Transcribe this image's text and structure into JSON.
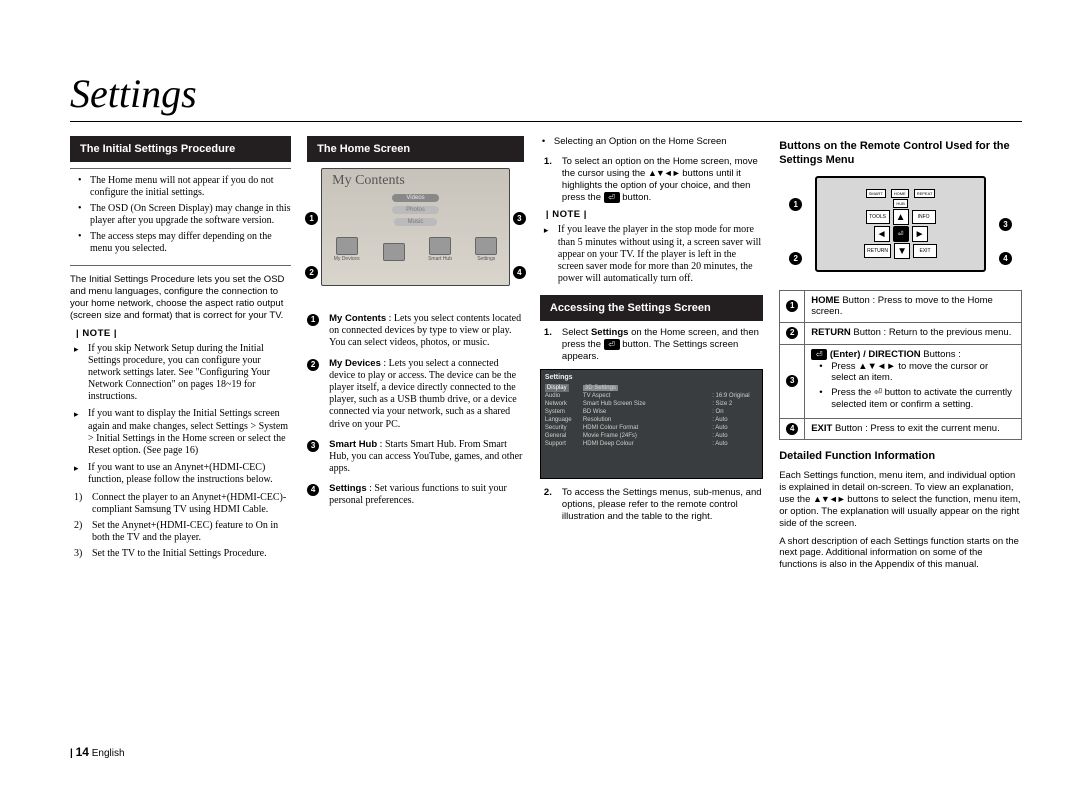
{
  "page_title": "Settings",
  "footer": {
    "page_number": "14",
    "lang": "English"
  },
  "col1": {
    "heading": "The Initial Settings Procedure",
    "top_box": [
      "The Home menu will not appear if you do not configure the initial settings.",
      "The OSD (On Screen Display) may change in this player after you upgrade the software version.",
      "The access steps may differ depending on the menu you selected."
    ],
    "intro": "The Initial Settings Procedure lets you set the OSD and menu languages, configure the connection to your home network, choose the aspect ratio output (screen size and format) that is correct for your TV.",
    "note_label": "NOTE",
    "notes": [
      "If you skip Network Setup during the Initial Settings procedure, you can configure your network settings later. See \"Configuring Your Network Connection\" on pages 18~19 for instructions.",
      "If you want to display the Initial Settings screen again and make changes, select Settings > System > Initial Settings in the Home screen or select the Reset option. (See page 16)",
      "If you want to use an Anynet+(HDMI-CEC) function, please follow the instructions below."
    ],
    "steps": [
      "Connect the player to an Anynet+(HDMI-CEC)-compliant Samsung TV using HDMI Cable.",
      "Set the Anynet+(HDMI-CEC) feature to On in both the TV and the player.",
      "Set the TV to the Initial Settings Procedure."
    ]
  },
  "col2": {
    "heading": "The Home Screen",
    "fig": {
      "title": "My Contents",
      "menu": [
        "Videos",
        "Photos",
        "Music"
      ],
      "icons": [
        "My Devices",
        "",
        "Smart Hub",
        "Settings"
      ]
    },
    "items": [
      {
        "n": "1",
        "bold": "My Contents",
        "text": " : Lets you select contents located on connected devices by type to view or play. You can select videos, photos, or music."
      },
      {
        "n": "2",
        "bold": "My Devices",
        "text": " : Lets you select a connected device to play or access. The device can be the player itself, a device directly connected to the player, such as a USB thumb drive, or a device connected via your network, such as a shared drive on your PC."
      },
      {
        "n": "3",
        "bold": "Smart Hub",
        "text": " : Starts Smart Hub. From Smart Hub, you can access YouTube, games, and other apps."
      },
      {
        "n": "4",
        "bold": "Settings",
        "text": " : Set various functions to suit your personal preferences."
      }
    ]
  },
  "col3": {
    "top_bullet": "Selecting an Option on the Home Screen",
    "step1_a": "To select an option on the Home screen, move the cursor using the ",
    "step1_b": " buttons until it highlights the option of your choice, and then press the ",
    "step1_c": " button.",
    "note_label": "NOTE",
    "note1": "If you leave the player in the stop mode for more than 5 minutes without using it, a screen saver will appear on your TV. If the player is left in the screen saver mode for more than 20 minutes, the power will automatically turn off.",
    "heading2": "Accessing the Settings Screen",
    "acc1_a": "Select ",
    "acc1_bold": "Settings",
    "acc1_b": " on the Home screen, and then press the ",
    "acc1_c": " button. The Settings screen appears.",
    "settings_fig": {
      "title": "Settings",
      "rows": [
        [
          "Display",
          "3D Settings",
          ""
        ],
        [
          "Audio",
          "TV Aspect",
          ": 16:9 Original"
        ],
        [
          "Network",
          "Smart Hub Screen Size",
          ": Size 2"
        ],
        [
          "System",
          "BD Wise",
          ": On"
        ],
        [
          "Language",
          "Resolution",
          ": Auto"
        ],
        [
          "Security",
          "HDMI Colour Format",
          ": Auto"
        ],
        [
          "General",
          "Movie Frame (24Fs)",
          ": Auto"
        ],
        [
          "Support",
          "HDMI Deep Colour",
          ": Auto"
        ]
      ]
    },
    "acc2": "To access the Settings menus, sub-menus, and options, please refer to the remote control illustration and the table to the right."
  },
  "col4": {
    "heading": "Buttons on the Remote Control Used for the Settings Menu",
    "remote_fig": {
      "top_row": [
        "SMART",
        "HOME",
        "REPEAT",
        "HUB"
      ],
      "mid_left": "TOOLS",
      "mid_right": "INFO",
      "bot_left": "RETURN",
      "bot_right": "EXIT"
    },
    "table": [
      {
        "n": "1",
        "bold": "HOME",
        "rest": " Button : Press to move to the Home screen."
      },
      {
        "n": "2",
        "bold": "RETURN",
        "rest": " Button : Return to the previous menu."
      },
      {
        "n": "3",
        "bold_enter": true,
        "dir_label": "(Enter) / DIRECTION",
        "dir_rest": " Buttons :",
        "sub": [
          "Press ▲▼◄► to move the cursor or select an item.",
          "Press the ⏎ button to activate the currently selected item or confirm a setting."
        ]
      },
      {
        "n": "4",
        "bold": "EXIT",
        "rest": " Button : Press to exit the current menu."
      }
    ],
    "detail_head": "Detailed Function Information",
    "detail_body_a": "Each Settings function, menu item, and individual option is explained in detail on-screen. To view an explanation, use the ",
    "detail_body_b": " buttons to select the function, menu item, or option. The explanation will usually appear on the right side of the screen.",
    "detail_body_c": "A short description of each Settings function starts on the next page. Additional information on some of the functions is also in the Appendix of this manual."
  }
}
